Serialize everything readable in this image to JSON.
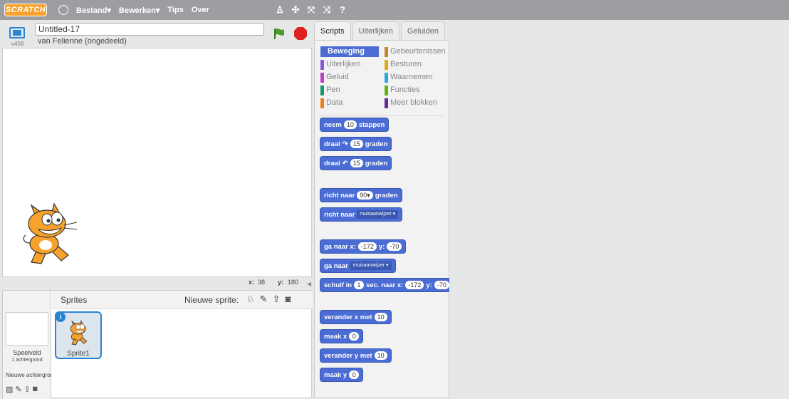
{
  "menubar": {
    "logo": "SCRATCH",
    "items": [
      "Bestand▾",
      "Bewerken▾",
      "Tips",
      "Over"
    ]
  },
  "toolbar_icons": [
    "stamp-icon",
    "grow-icon",
    "shrink-icon",
    "help-icon"
  ],
  "stage": {
    "version": "v458",
    "project_title": "Untitled-17",
    "byline": "van Felienne (ongedeeld)",
    "mouse": {
      "x_label": "x:",
      "x": "38",
      "y_label": "y:",
      "y": "180"
    }
  },
  "sprites": {
    "title": "Sprites",
    "new_sprite": "Nieuwe sprite:",
    "stage_label": "Speelveld",
    "stage_sub": "1 achtergrond",
    "new_backdrop": "Nieuwe achtergrond:",
    "selected_sprite": "Sprite1",
    "info": "i"
  },
  "tabs": [
    "Scripts",
    "Uiterlijken",
    "Geluiden"
  ],
  "categories": [
    {
      "label": "Beweging",
      "color": "#4a6cd4"
    },
    {
      "label": "Uiterlijken",
      "color": "#8a55d7"
    },
    {
      "label": "Geluid",
      "color": "#bb42c3"
    },
    {
      "label": "Pen",
      "color": "#0e9a6c"
    },
    {
      "label": "Data",
      "color": "#ee7d16"
    },
    {
      "label": "Gebeurtenissen",
      "color": "#c88330"
    },
    {
      "label": "Besturen",
      "color": "#e1a91a"
    },
    {
      "label": "Waarnemen",
      "color": "#2ca5e2"
    },
    {
      "label": "Functies",
      "color": "#5cb712"
    },
    {
      "label": "Meer blokken",
      "color": "#632d99"
    }
  ],
  "blocks": [
    {
      "parts": [
        {
          "t": "neem"
        },
        {
          "p": "10"
        },
        {
          "t": "stappen"
        }
      ]
    },
    {
      "parts": [
        {
          "t": "draai"
        },
        {
          "t": "↷"
        },
        {
          "p": "15"
        },
        {
          "t": "graden"
        }
      ]
    },
    {
      "parts": [
        {
          "t": "draai"
        },
        {
          "t": "↶"
        },
        {
          "p": "15"
        },
        {
          "t": "graden"
        }
      ]
    },
    {
      "parts": [
        {
          "t": "richt naar"
        },
        {
          "p": "90▾"
        },
        {
          "t": "graden"
        }
      ]
    },
    {
      "parts": [
        {
          "t": "richt naar"
        },
        {
          "d": "muisaanwijzer ▾"
        }
      ]
    },
    {
      "parts": [
        {
          "t": "ga naar x:"
        },
        {
          "p": "-172"
        },
        {
          "t": "y:"
        },
        {
          "p": "-70"
        }
      ]
    },
    {
      "parts": [
        {
          "t": "ga naar"
        },
        {
          "d": "muisaanwijzer ▾"
        }
      ]
    },
    {
      "parts": [
        {
          "t": "schuif in"
        },
        {
          "p": "1"
        },
        {
          "t": "sec. naar x:"
        },
        {
          "p": "-172"
        },
        {
          "t": "y:"
        },
        {
          "p": "-70"
        }
      ]
    },
    {
      "parts": [
        {
          "t": "verander x met"
        },
        {
          "p": "10"
        }
      ]
    },
    {
      "parts": [
        {
          "t": "maak x"
        },
        {
          "p": "0"
        }
      ]
    },
    {
      "parts": [
        {
          "t": "verander y met"
        },
        {
          "p": "10"
        }
      ]
    },
    {
      "parts": [
        {
          "t": "maak y"
        },
        {
          "p": "0"
        }
      ]
    }
  ]
}
